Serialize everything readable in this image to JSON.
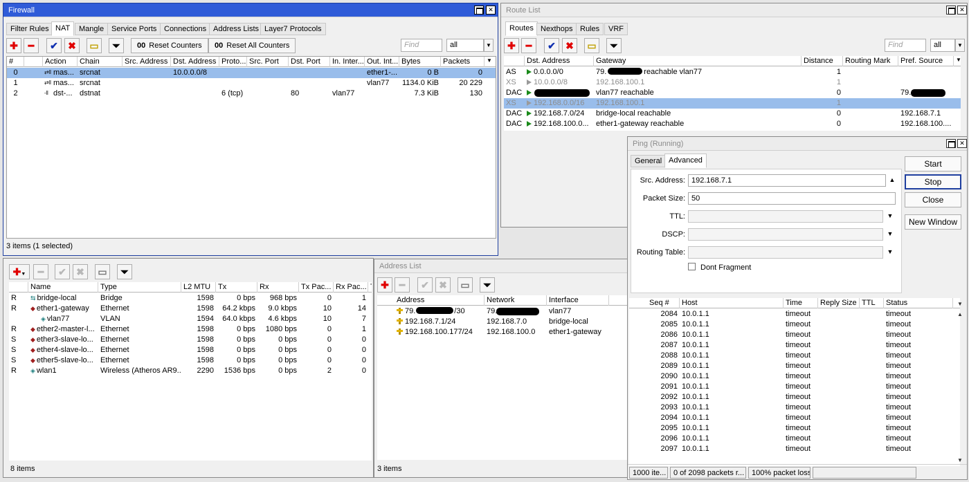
{
  "firewall": {
    "title": "Firewall",
    "tabs": [
      "Filter Rules",
      "NAT",
      "Mangle",
      "Service Ports",
      "Connections",
      "Address Lists",
      "Layer7 Protocols"
    ],
    "selected_tab": "NAT",
    "reset_counters": "Reset Counters",
    "reset_all_counters": "Reset All Counters",
    "counter_glyph": "00",
    "find_placeholder": "Find",
    "filter_value": "all",
    "columns": [
      "#",
      "",
      "Action",
      "Chain",
      "Src. Address",
      "Dst. Address",
      "Proto...",
      "Src. Port",
      "Dst. Port",
      "In. Inter...",
      "Out. Int...",
      "Bytes",
      "Packets"
    ],
    "rows": [
      {
        "num": "0",
        "action": "mas...",
        "chain": "srcnat",
        "dst_address": "10.0.0.0/8",
        "protocol": "",
        "dst_port": "",
        "in_interface": "",
        "out_interface": "ether1-...",
        "bytes": "0 B",
        "packets": "0",
        "selected": true
      },
      {
        "num": "1",
        "action": "mas...",
        "chain": "srcnat",
        "dst_address": "",
        "protocol": "",
        "dst_port": "",
        "in_interface": "",
        "out_interface": "vlan77",
        "bytes": "1134.0 KiB",
        "packets": "20 229",
        "selected": false
      },
      {
        "num": "2",
        "action": "dst-...",
        "chain": "dstnat",
        "dst_address": "",
        "protocol": "6 (tcp)",
        "dst_port": "80",
        "in_interface": "vlan77",
        "out_interface": "",
        "bytes": "7.3 KiB",
        "packets": "130",
        "selected": false
      }
    ],
    "status": "3 items (1 selected)"
  },
  "route_list": {
    "title": "Route List",
    "tabs": [
      "Routes",
      "Nexthops",
      "Rules",
      "VRF"
    ],
    "selected_tab": "Routes",
    "find_placeholder": "Find",
    "filter_value": "all",
    "columns": [
      "",
      "Dst. Address",
      "Gateway",
      "Distance",
      "Routing Mark",
      "Pref. Source"
    ],
    "rows": [
      {
        "flags": "AS",
        "dst": "0.0.0.0/0",
        "gateway": "79.",
        "gateway_tail": "reachable vlan77",
        "distance": "1",
        "mark": "",
        "pref": "",
        "dim": false,
        "selected": false
      },
      {
        "flags": "XS",
        "dst": "10.0.0.0/8",
        "gateway": "192.168.100.1",
        "gateway_tail": "",
        "distance": "1",
        "mark": "",
        "pref": "",
        "dim": true,
        "selected": false
      },
      {
        "flags": "DAC",
        "dst": "",
        "gateway": "",
        "gateway_tail": "vlan77 reachable",
        "distance": "0",
        "mark": "",
        "pref": "79.",
        "dim": false,
        "selected": false
      },
      {
        "flags": "XS",
        "dst": "192.168.0.0/16",
        "gateway": "192.168.100.1",
        "gateway_tail": "",
        "distance": "1",
        "mark": "",
        "pref": "",
        "dim": true,
        "selected": true
      },
      {
        "flags": "DAC",
        "dst": "192.168.7.0/24",
        "gateway": "bridge-local reachable",
        "gateway_tail": "",
        "distance": "0",
        "mark": "",
        "pref": "192.168.7.1",
        "dim": false,
        "selected": false
      },
      {
        "flags": "DAC",
        "dst": "192.168.100.0...",
        "gateway": "ether1-gateway reachable",
        "gateway_tail": "",
        "distance": "0",
        "mark": "",
        "pref": "192.168.100....",
        "dim": false,
        "selected": false
      }
    ]
  },
  "interfaces": {
    "columns": [
      "",
      "Name",
      "Type",
      "L2 MTU",
      "Tx",
      "Rx",
      "Tx Pac...",
      "Rx Pac...",
      "T"
    ],
    "rows": [
      {
        "flag": "R",
        "name": "bridge-local",
        "type": "Bridge",
        "mtu": "1598",
        "tx": "0 bps",
        "rx": "968 bps",
        "txp": "0",
        "rxp": "1",
        "indent": false
      },
      {
        "flag": "R",
        "name": "ether1-gateway",
        "type": "Ethernet",
        "mtu": "1598",
        "tx": "64.2 kbps",
        "rx": "9.0 kbps",
        "txp": "10",
        "rxp": "14",
        "indent": false
      },
      {
        "flag": "",
        "name": "vlan77",
        "type": "VLAN",
        "mtu": "1594",
        "tx": "64.0 kbps",
        "rx": "4.6 kbps",
        "txp": "10",
        "rxp": "7",
        "indent": true
      },
      {
        "flag": "R",
        "name": "ether2-master-l...",
        "type": "Ethernet",
        "mtu": "1598",
        "tx": "0 bps",
        "rx": "1080 bps",
        "txp": "0",
        "rxp": "1",
        "indent": false
      },
      {
        "flag": "S",
        "name": "ether3-slave-lo...",
        "type": "Ethernet",
        "mtu": "1598",
        "tx": "0 bps",
        "rx": "0 bps",
        "txp": "0",
        "rxp": "0",
        "indent": false
      },
      {
        "flag": "S",
        "name": "ether4-slave-lo...",
        "type": "Ethernet",
        "mtu": "1598",
        "tx": "0 bps",
        "rx": "0 bps",
        "txp": "0",
        "rxp": "0",
        "indent": false
      },
      {
        "flag": "S",
        "name": "ether5-slave-lo...",
        "type": "Ethernet",
        "mtu": "1598",
        "tx": "0 bps",
        "rx": "0 bps",
        "txp": "0",
        "rxp": "0",
        "indent": false
      },
      {
        "flag": "R",
        "name": "wlan1",
        "type": "Wireless (Atheros AR9...",
        "mtu": "2290",
        "tx": "1536 bps",
        "rx": "0 bps",
        "txp": "2",
        "rxp": "0",
        "indent": false
      }
    ],
    "status": "8 items"
  },
  "address_list": {
    "title": "Address List",
    "columns": [
      "Address",
      "Network",
      "Interface"
    ],
    "rows": [
      {
        "address": "79.",
        "address_tail": "/30",
        "network": "79.",
        "interface": "vlan77"
      },
      {
        "address": "192.168.7.1/24",
        "address_tail": "",
        "network": "192.168.7.0",
        "interface": "bridge-local"
      },
      {
        "address": "192.168.100.177/24",
        "address_tail": "",
        "network": "192.168.100.0",
        "interface": "ether1-gateway"
      }
    ],
    "status": "3 items"
  },
  "ping": {
    "title": "Ping (Running)",
    "tabs": [
      "General",
      "Advanced"
    ],
    "selected_tab": "Advanced",
    "src_address_label": "Src. Address:",
    "src_address": "192.168.7.1",
    "packet_size_label": "Packet Size:",
    "packet_size": "50",
    "ttl_label": "TTL:",
    "dscp_label": "DSCP:",
    "routing_table_label": "Routing Table:",
    "dont_fragment_label": "Dont Fragment",
    "buttons": {
      "start": "Start",
      "stop": "Stop",
      "close": "Close",
      "new_window": "New Window"
    },
    "columns": [
      "Seq #",
      "Host",
      "Time",
      "Reply Size",
      "TTL",
      "Status"
    ],
    "rows": [
      {
        "seq": "2084",
        "host": "10.0.1.1",
        "time": "timeout",
        "status": "timeout"
      },
      {
        "seq": "2085",
        "host": "10.0.1.1",
        "time": "timeout",
        "status": "timeout"
      },
      {
        "seq": "2086",
        "host": "10.0.1.1",
        "time": "timeout",
        "status": "timeout"
      },
      {
        "seq": "2087",
        "host": "10.0.1.1",
        "time": "timeout",
        "status": "timeout"
      },
      {
        "seq": "2088",
        "host": "10.0.1.1",
        "time": "timeout",
        "status": "timeout"
      },
      {
        "seq": "2089",
        "host": "10.0.1.1",
        "time": "timeout",
        "status": "timeout"
      },
      {
        "seq": "2090",
        "host": "10.0.1.1",
        "time": "timeout",
        "status": "timeout"
      },
      {
        "seq": "2091",
        "host": "10.0.1.1",
        "time": "timeout",
        "status": "timeout"
      },
      {
        "seq": "2092",
        "host": "10.0.1.1",
        "time": "timeout",
        "status": "timeout"
      },
      {
        "seq": "2093",
        "host": "10.0.1.1",
        "time": "timeout",
        "status": "timeout"
      },
      {
        "seq": "2094",
        "host": "10.0.1.1",
        "time": "timeout",
        "status": "timeout"
      },
      {
        "seq": "2095",
        "host": "10.0.1.1",
        "time": "timeout",
        "status": "timeout"
      },
      {
        "seq": "2096",
        "host": "10.0.1.1",
        "time": "timeout",
        "status": "timeout"
      },
      {
        "seq": "2097",
        "host": "10.0.1.1",
        "time": "timeout",
        "status": "timeout"
      }
    ],
    "status_items": "1000 ite...",
    "status_packets": "0 of 2098 packets r...",
    "status_loss": "100% packet loss"
  },
  "icons": {
    "add": "add-icon",
    "remove": "remove-icon",
    "enable": "check-icon",
    "disable": "cross-icon",
    "comment": "comment-icon",
    "filter": "filter-icon",
    "close": "close-icon",
    "maximize": "maximize-icon"
  },
  "colors": {
    "active_title": "#2f5bd8",
    "selection": "#99bdeb",
    "red": "#e00000",
    "blue": "#1030b0",
    "route_flag": "#1a8a1a"
  }
}
